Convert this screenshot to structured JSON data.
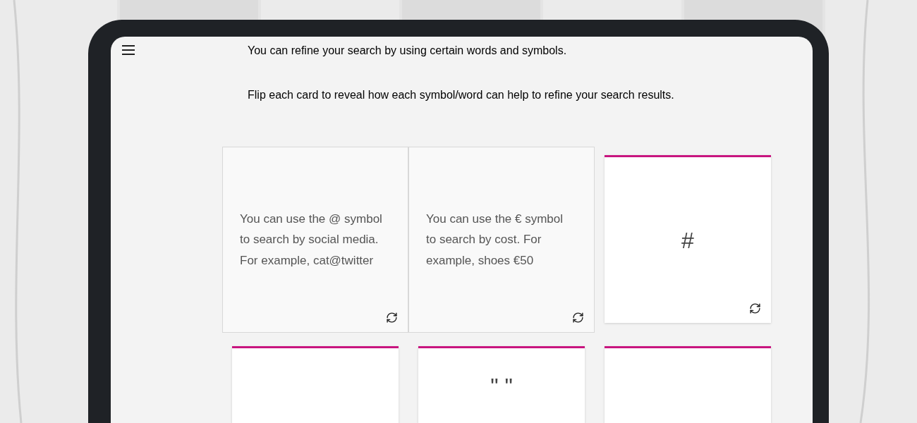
{
  "intro": [
    "You can refine your search by using certain words and symbols.",
    "Flip each card to reveal how each symbol/word can help to refine your search results."
  ],
  "cards": [
    {
      "kind": "back",
      "text": "You can use the @ symbol to search by social media. For example, cat@twitter"
    },
    {
      "kind": "back",
      "text": "You can use the € symbol to search by cost. For example, shoes €50"
    },
    {
      "kind": "front",
      "symbol": "#"
    },
    {
      "kind": "front"
    },
    {
      "kind": "front",
      "symbol": "\" \""
    },
    {
      "kind": "front"
    }
  ]
}
